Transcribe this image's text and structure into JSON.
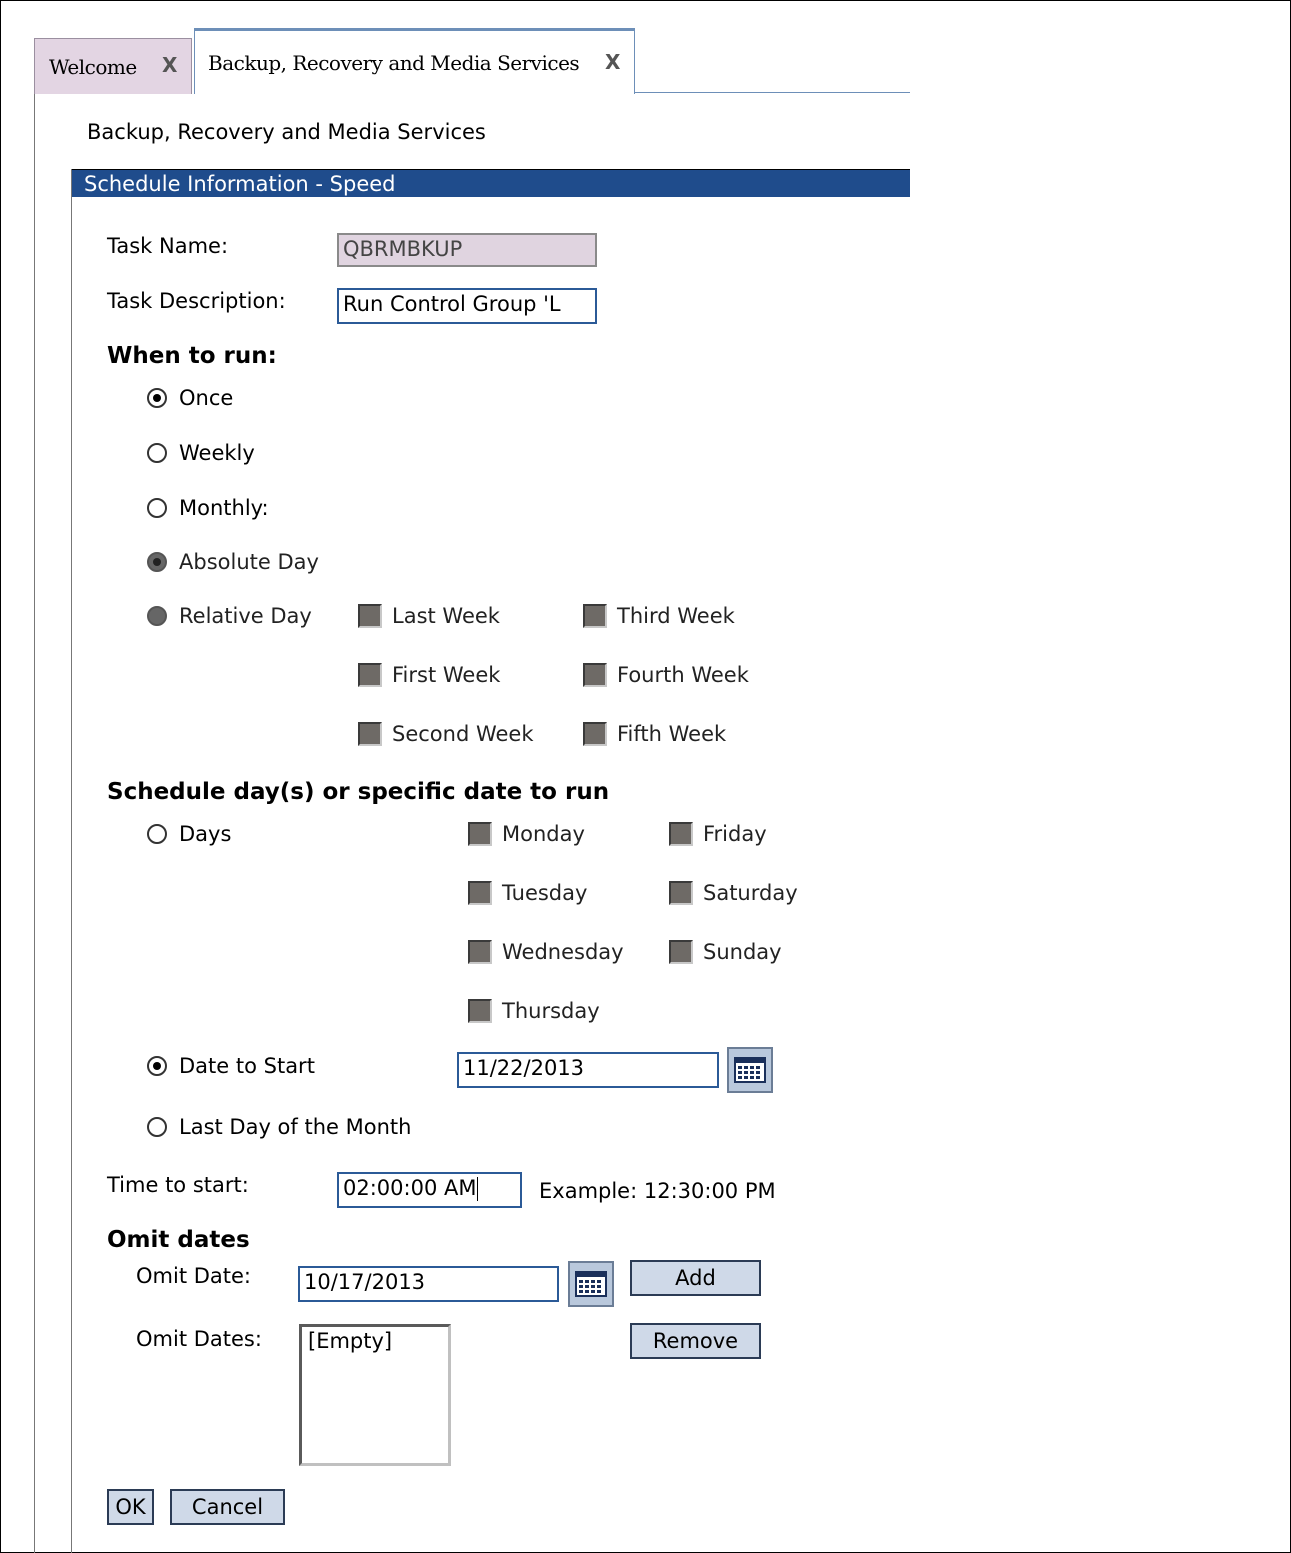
{
  "tabs": [
    {
      "label": "Welcome",
      "close": "X"
    },
    {
      "label": "Backup, Recovery and Media Services",
      "close": "X"
    }
  ],
  "breadcrumb": "Backup, Recovery and Media Services",
  "section_header": "Schedule Information - Speed",
  "task": {
    "name_label": "Task Name:",
    "name_value": "QBRMBKUP",
    "desc_label": "Task Description:",
    "desc_value": "Run Control Group 'L"
  },
  "when_to_run": {
    "heading": "When to run:",
    "once": "Once",
    "weekly": "Weekly",
    "monthly": "Monthly:",
    "absolute_day": "Absolute Day",
    "relative_day": "Relative Day",
    "weeks": {
      "last": "Last Week",
      "first": "First Week",
      "second": "Second Week",
      "third": "Third Week",
      "fourth": "Fourth Week",
      "fifth": "Fifth Week"
    },
    "selected": "Once"
  },
  "schedule": {
    "heading": "Schedule day(s) or specific date to run",
    "days_label": "Days",
    "days": {
      "monday": "Monday",
      "tuesday": "Tuesday",
      "wednesday": "Wednesday",
      "thursday": "Thursday",
      "friday": "Friday",
      "saturday": "Saturday",
      "sunday": "Sunday"
    },
    "date_to_start_label": "Date to Start",
    "date_to_start_value": "11/22/2013",
    "last_day_label": "Last Day of the Month",
    "selected": "Date to Start"
  },
  "time": {
    "label": "Time to start:",
    "value": "02:00:00 AM",
    "example": "Example: 12:30:00 PM"
  },
  "omit": {
    "heading": "Omit dates",
    "date_label": "Omit Date:",
    "date_value": "10/17/2013",
    "add": "Add",
    "dates_label": "Omit Dates:",
    "list": [
      "[Empty]"
    ],
    "remove": "Remove"
  },
  "actions": {
    "ok": "OK",
    "cancel": "Cancel"
  }
}
